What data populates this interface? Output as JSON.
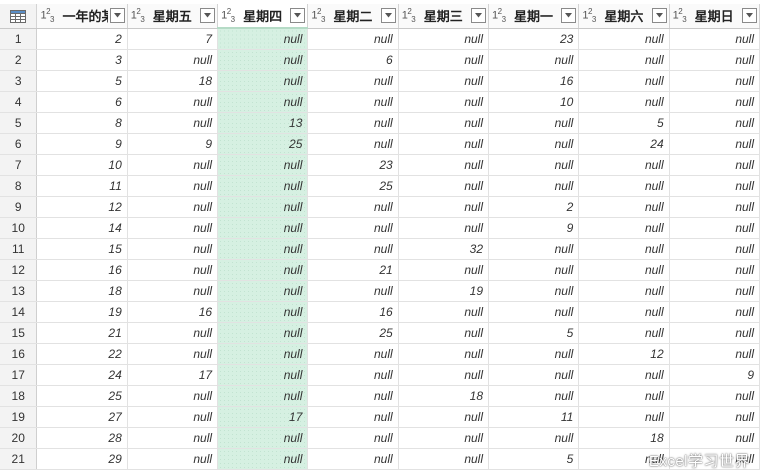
{
  "table": {
    "corner_icon": "table-icon",
    "columns": [
      {
        "name": "一年的某...",
        "type_label": "123"
      },
      {
        "name": "星期五",
        "type_label": "123"
      },
      {
        "name": "星期四",
        "type_label": "123",
        "highlighted": true
      },
      {
        "name": "星期二",
        "type_label": "123"
      },
      {
        "name": "星期三",
        "type_label": "123"
      },
      {
        "name": "星期一",
        "type_label": "123"
      },
      {
        "name": "星期六",
        "type_label": "123"
      },
      {
        "name": "星期日",
        "type_label": "123"
      }
    ],
    "rows": [
      {
        "index": "1",
        "cells": [
          "2",
          "7",
          "null",
          "null",
          "null",
          "23",
          "null",
          "null"
        ]
      },
      {
        "index": "2",
        "cells": [
          "3",
          "null",
          "null",
          "6",
          "null",
          "null",
          "null",
          "null"
        ]
      },
      {
        "index": "3",
        "cells": [
          "5",
          "18",
          "null",
          "null",
          "null",
          "16",
          "null",
          "null"
        ]
      },
      {
        "index": "4",
        "cells": [
          "6",
          "null",
          "null",
          "null",
          "null",
          "10",
          "null",
          "null"
        ]
      },
      {
        "index": "5",
        "cells": [
          "8",
          "null",
          "13",
          "null",
          "null",
          "null",
          "5",
          "null"
        ]
      },
      {
        "index": "6",
        "cells": [
          "9",
          "9",
          "25",
          "null",
          "null",
          "null",
          "24",
          "null"
        ]
      },
      {
        "index": "7",
        "cells": [
          "10",
          "null",
          "null",
          "23",
          "null",
          "null",
          "null",
          "null"
        ]
      },
      {
        "index": "8",
        "cells": [
          "11",
          "null",
          "null",
          "25",
          "null",
          "null",
          "null",
          "null"
        ]
      },
      {
        "index": "9",
        "cells": [
          "12",
          "null",
          "null",
          "null",
          "null",
          "2",
          "null",
          "null"
        ]
      },
      {
        "index": "10",
        "cells": [
          "14",
          "null",
          "null",
          "null",
          "null",
          "9",
          "null",
          "null"
        ]
      },
      {
        "index": "11",
        "cells": [
          "15",
          "null",
          "null",
          "null",
          "32",
          "null",
          "null",
          "null"
        ]
      },
      {
        "index": "12",
        "cells": [
          "16",
          "null",
          "null",
          "21",
          "null",
          "null",
          "null",
          "null"
        ]
      },
      {
        "index": "13",
        "cells": [
          "18",
          "null",
          "null",
          "null",
          "19",
          "null",
          "null",
          "null"
        ]
      },
      {
        "index": "14",
        "cells": [
          "19",
          "16",
          "null",
          "16",
          "null",
          "null",
          "null",
          "null"
        ]
      },
      {
        "index": "15",
        "cells": [
          "21",
          "null",
          "null",
          "25",
          "null",
          "5",
          "null",
          "null"
        ]
      },
      {
        "index": "16",
        "cells": [
          "22",
          "null",
          "null",
          "null",
          "null",
          "null",
          "12",
          "null"
        ]
      },
      {
        "index": "17",
        "cells": [
          "24",
          "17",
          "null",
          "null",
          "null",
          "null",
          "null",
          "9"
        ]
      },
      {
        "index": "18",
        "cells": [
          "25",
          "null",
          "null",
          "null",
          "18",
          "null",
          "null",
          "null"
        ]
      },
      {
        "index": "19",
        "cells": [
          "27",
          "null",
          "17",
          "null",
          "null",
          "11",
          "null",
          "null"
        ]
      },
      {
        "index": "20",
        "cells": [
          "28",
          "null",
          "null",
          "null",
          "null",
          "null",
          "18",
          "null"
        ]
      },
      {
        "index": "21",
        "cells": [
          "29",
          "null",
          "null",
          "null",
          "null",
          "5",
          "null",
          "null"
        ]
      }
    ]
  },
  "watermark": "Excel学习世界",
  "colors": {
    "highlight_column_bg": "#d6f0e2",
    "header_bg": "#fafafa",
    "grid_line": "#e2e2e2"
  }
}
